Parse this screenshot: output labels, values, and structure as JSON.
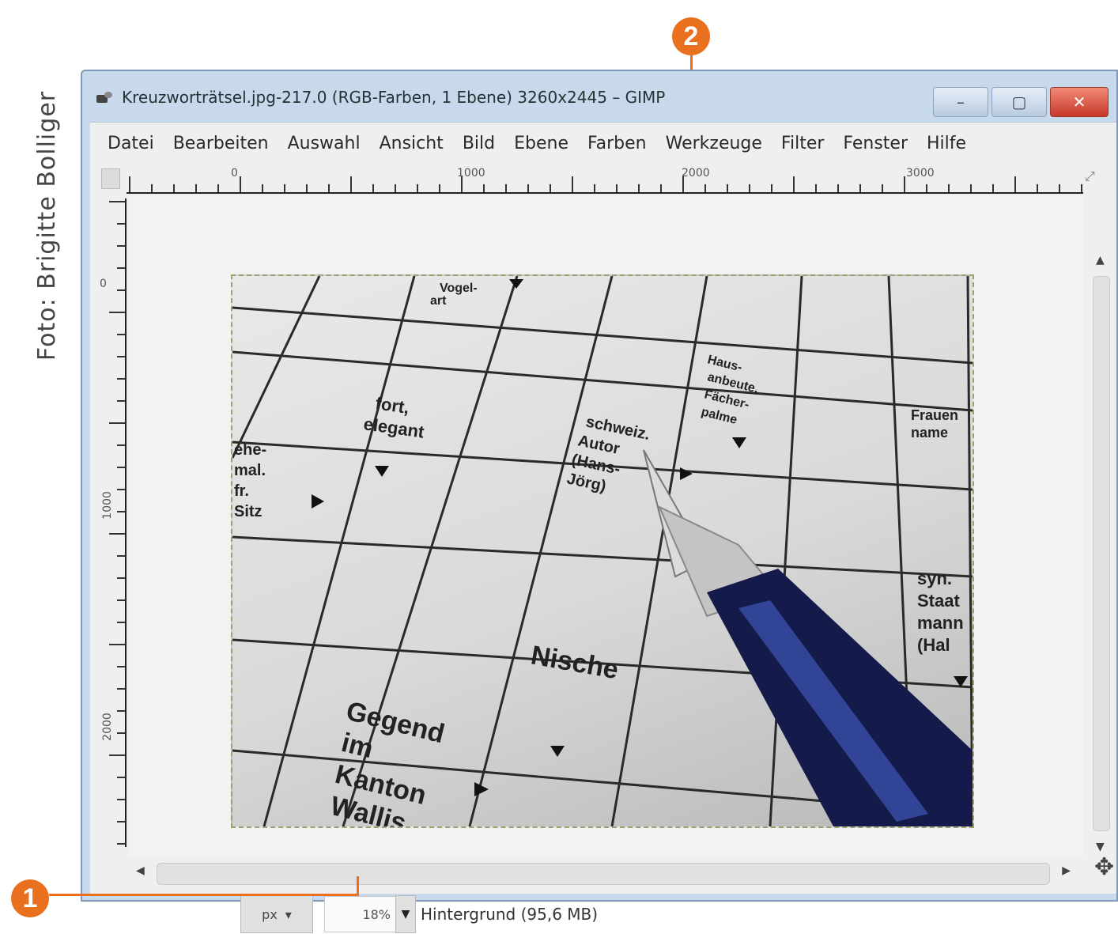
{
  "photo_credit": "Foto: Brigitte Bolliger",
  "callouts": {
    "zoom": "1",
    "dimensions": "2"
  },
  "window": {
    "title": "Kreuzworträtsel.jpg-217.0 (RGB-Farben, 1 Ebene) 3260x2445 – GIMP",
    "controls": {
      "minimize": "–",
      "maximize": "▢",
      "close": "✕"
    }
  },
  "menu": [
    "Datei",
    "Bearbeiten",
    "Auswahl",
    "Ansicht",
    "Bild",
    "Ebene",
    "Farben",
    "Werkzeuge",
    "Filter",
    "Fenster",
    "Hilfe"
  ],
  "ruler": {
    "h_ticks": [
      "0",
      "1000",
      "2000",
      "3000"
    ],
    "v_ticks": [
      "0",
      "1000",
      "2000"
    ]
  },
  "image_content": {
    "clues": {
      "c1": "Vogel-",
      "c2": "art",
      "c3": "fort,",
      "c4": "elegant",
      "c5": "schweiz.",
      "c6": "Autor",
      "c7": "(Hans-",
      "c8": "Jörg)",
      "c9": "Nische",
      "c10": "Gegend",
      "c11": "im",
      "c12": "Kanton",
      "c13": "Wallis",
      "c14": "syn.",
      "c15": "Staat",
      "c16": "mann",
      "c17": "(Hal",
      "c18": "Frauen",
      "c19": "name",
      "c20": "Haus-",
      "c21": "anbeute,",
      "c22": "Fächer-",
      "c23": "palme",
      "c24": "ehe-",
      "c25": "mal.",
      "c26": "fr.",
      "c27": "Sitz"
    }
  },
  "statusbar": {
    "unit": "px",
    "zoom": "18%",
    "info": "Hintergrund (95,6 MB)"
  }
}
